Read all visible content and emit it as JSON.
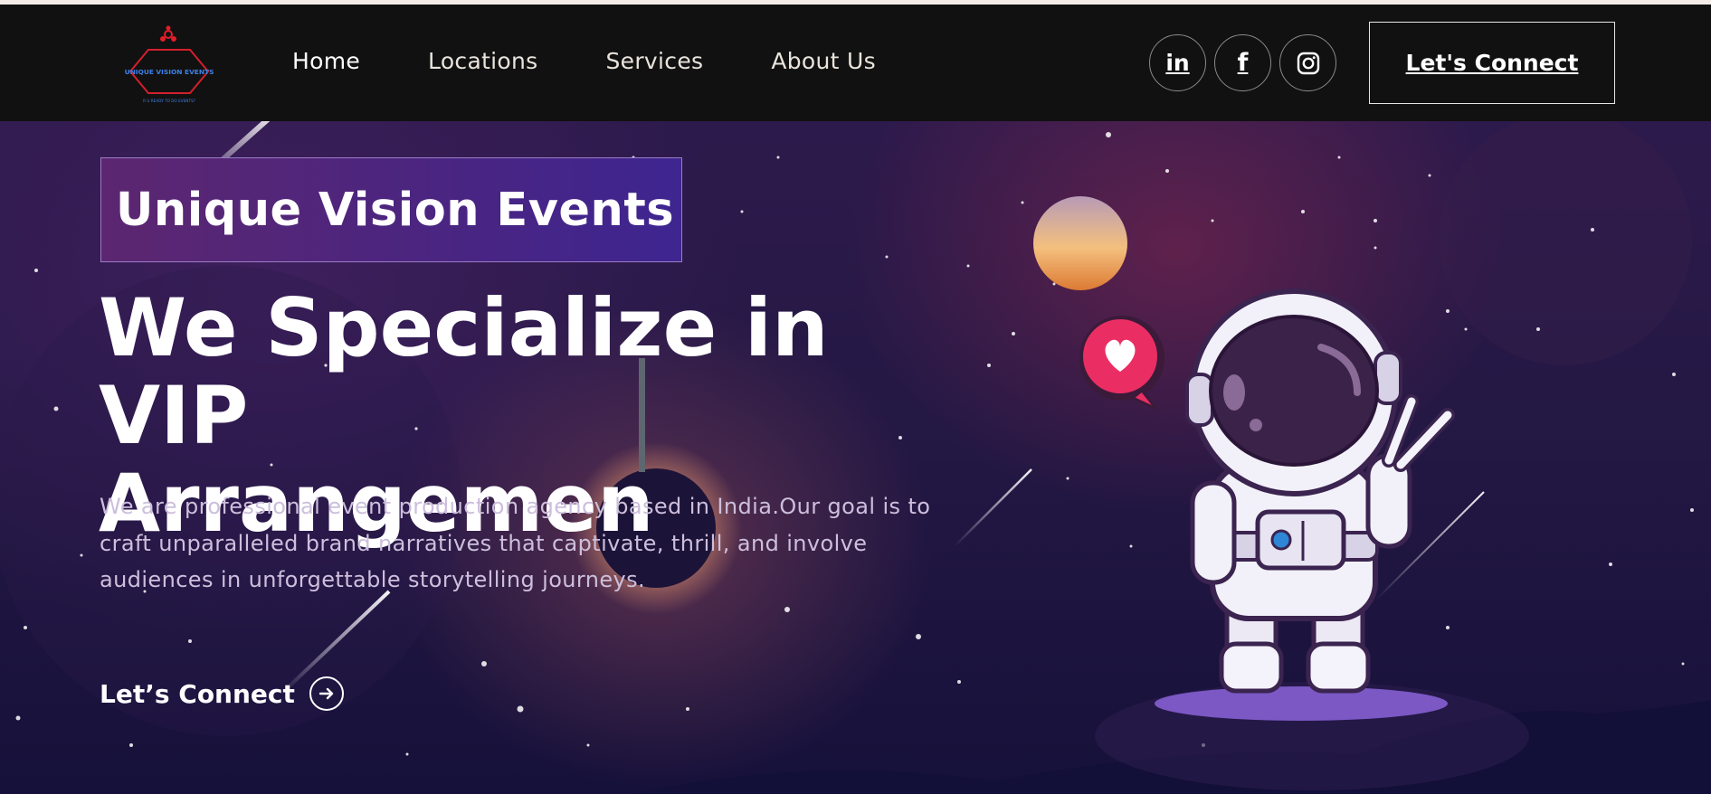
{
  "logo": {
    "text": "UNIQUE VISION EVENTS",
    "tagline": "R U READY TO DO EVENTS?"
  },
  "nav": {
    "items": [
      {
        "label": "Home"
      },
      {
        "label": "Locations"
      },
      {
        "label": "Services"
      },
      {
        "label": "About Us"
      }
    ],
    "socials": [
      {
        "icon": "linkedin-icon",
        "glyph": "in"
      },
      {
        "icon": "facebook-icon",
        "glyph": "f"
      },
      {
        "icon": "instagram-icon",
        "glyph": ""
      }
    ],
    "cta_label": "Let's Connect"
  },
  "hero": {
    "brand_tag": "Unique Vision Events",
    "headline_line1": "We Specialize in VIP",
    "headline_line2": "Arrangemen",
    "description": "We are professional event production agency based in India.Our goal is to craft unparalleled brand narratives that captivate, thrill, and involve audiences in unforgettable storytelling journeys.",
    "cta_label": "Let’s Connect",
    "cta_icon": "arrow-right-circle-icon"
  },
  "colors": {
    "nav_bg": "#111111",
    "hero_bg_top": "#2d1a4c",
    "hero_bg_bottom": "#16113a",
    "brand_tag_start": "#5c2670",
    "brand_tag_end": "#3e2590",
    "heart_badge": "#e6245a",
    "astronaut_platform": "#7b58c4"
  }
}
